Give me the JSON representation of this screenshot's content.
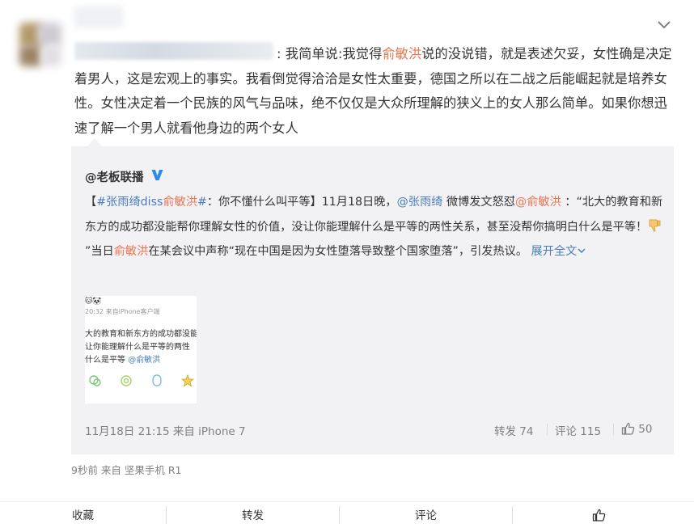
{
  "post": {
    "author_blurred": true,
    "text_prefix": ": 我简单说:我觉得",
    "mention_name": "俞敏洪",
    "text_main": "说的没说错，就是表述欠妥，女性确是决定着男人，这是宏观上的事实。我看倒觉得洽洽是女性太重要，德国之所以在二战之后能崛起就是培养女性。女性决定着一个民族的风气与品味，绝不仅仅是大众所理解的狭义上的女人那么简单。如果你想迅速了解一个男人就看他身边的两个女人",
    "footer": "9秒前 来自 坚果手机 R1"
  },
  "repost": {
    "author": "@老板联播",
    "seg1": "【",
    "hashtag": "#张雨绮diss",
    "hashtag_red": "俞敏洪",
    "hashtag_end": "#",
    "seg2": "：你不懂什么叫平等】11月18日晚，",
    "mention1": "@张雨绮",
    "seg3": " 微博发文怒怼",
    "mention2": "@俞敏洪",
    "seg4": " ：“北大的教育和新东方的成功都没能帮你理解女性的价值，没让你能理解什么是平等的两性关系，甚至没帮你搞明白什么是平等！",
    "seg5": "”当日",
    "red_name": "俞敏洪",
    "seg6": "在某会议中声称“现在中国是因为女性堕落导致整个国家堕落”，引发热议。",
    "expand": "展开全文",
    "thumbnail": {
      "meta": "20:32  来自iPhone客户端",
      "line1": "大的教育和新东方的成功都没能",
      "line2": "让你能理解什么是平等的两性",
      "line3": "什么是平等 ",
      "line3_mention": "@俞敏洪"
    },
    "time_source": "11月18日 21:15 来自 iPhone 7",
    "forwards": "转发 74",
    "comments": "评论 115",
    "likes": "50"
  },
  "actions": {
    "favorite": "收藏",
    "forward": "转发",
    "comment": "评论"
  },
  "icons": {
    "chevron": "chevron-down-icon",
    "verified": "verified-v-icon",
    "like": "thumbs-up-icon"
  },
  "colors": {
    "link": "#eb7350",
    "blue_link": "#4a7dba",
    "repost_bg": "#f2f2f5",
    "muted": "#808080"
  }
}
